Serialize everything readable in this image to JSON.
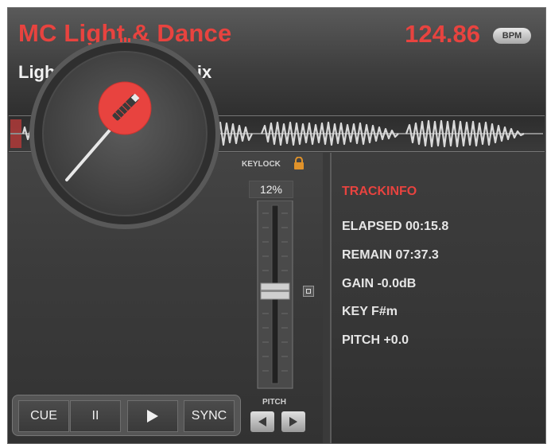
{
  "header": {
    "artist": "MC Light & Dance",
    "title": "Light and Dance Remix",
    "bpm": "124.86",
    "bpm_badge": "BPM"
  },
  "controls": {
    "keylock_label": "KEYLOCK",
    "pitch_readout": "12%",
    "pitch_label": "PITCH"
  },
  "transport": {
    "cue": "CUE",
    "pause": "II",
    "sync": "SYNC"
  },
  "trackinfo": {
    "title": "TRACKINFO",
    "rows": [
      "ELAPSED 00:15.8",
      "REMAIN 07:37.3",
      "GAIN -0.0dB",
      "KEY F#m",
      "PITCH +0.0"
    ]
  },
  "colors": {
    "accent_red": "#e8433f",
    "text_light": "#e6e6e6",
    "panel_dark": "#3a3a3a"
  },
  "icons": [
    "lock-icon",
    "play-icon",
    "pause-icon",
    "arrow-left-icon",
    "arrow-right-icon",
    "tonearm-icon"
  ]
}
